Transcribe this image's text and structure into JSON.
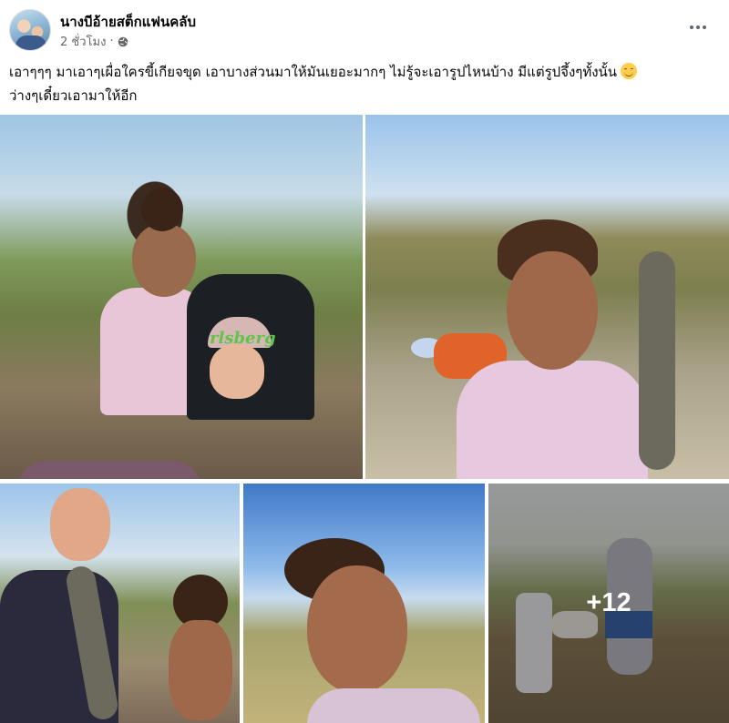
{
  "post": {
    "page_name": "นางบีอ้ายสต็กแฟนคลับ",
    "timestamp": "2 ชั่วโมง",
    "separator": "·",
    "privacy_icon": "globe-icon",
    "more_icon": "more-options-icon",
    "caption_line1": "เอาๆๆๆ มาเอาๆเผื่อใครขี้เกียจขุด เอาบางส่วนมาให้มันเยอะมากๆ ไม่รู้จะเอารูปไหนบ้าง มีแต่รูปจึ้งๆทั้งนั้น",
    "caption_emoji": "smiling-face-emoji",
    "caption_line2": "ว่างๆเดี๋ยวเอามาให้อีก"
  },
  "photos": {
    "photo_1": {
      "logo_text": "rlsberg"
    },
    "more_count": "+12"
  }
}
